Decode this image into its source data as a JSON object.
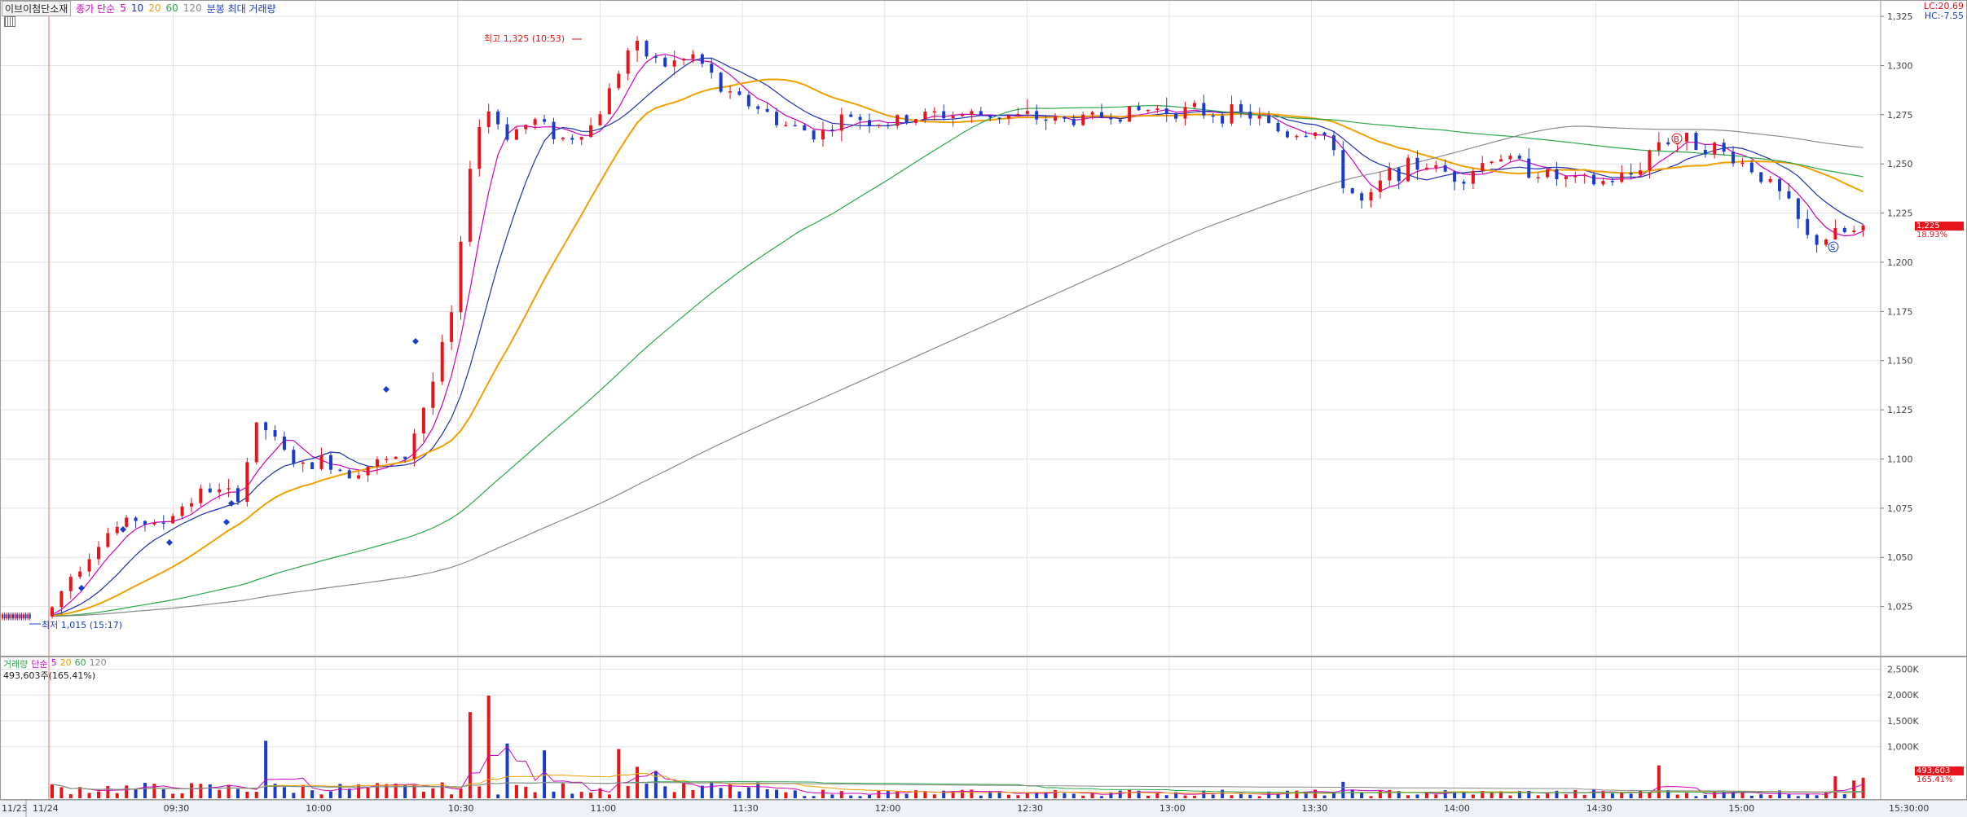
{
  "header": {
    "stock_name": "이브이첨단소재",
    "price_ma_label": "종가 단순",
    "ma_periods": [
      "5",
      "10",
      "20",
      "60",
      "120"
    ],
    "ma_colors": [
      "#d000c0",
      "#1f2fb0",
      "#f0a000",
      "#2aa84a",
      "#8a8a8a"
    ],
    "volume_label": "분봉 최대 거래량",
    "lc_label": "LC:20.69",
    "hc_label": "HC:-7.55"
  },
  "volume_header": {
    "label": "거래량",
    "ma_label": "단순",
    "periods": [
      "5",
      "20",
      "60",
      "120"
    ],
    "current": "493,603주(165.41%)"
  },
  "annotations": {
    "high": "최고 1,325 (10:53)",
    "low": "최저 1,015 (15:17)",
    "badge_b": "B",
    "badge_s": "S"
  },
  "last_price_tag": {
    "price": "1,225",
    "pct": "18.93%"
  },
  "last_volume_tag": {
    "volume": "493,603",
    "pct": "165.41%"
  },
  "colors": {
    "up": "#e8141c",
    "down": "#1a3cc8",
    "grid": "#e3e3e3"
  },
  "chart_data": {
    "type": "candlestick",
    "price_axis": {
      "min": 1000,
      "max": 1330,
      "ticks": [
        1025,
        1050,
        1075,
        1100,
        1125,
        1150,
        1175,
        1200,
        1225,
        1250,
        1275,
        1300,
        1325
      ],
      "tick_labels": [
        "1,025",
        "1,050",
        "1,075",
        "1,100",
        "1,125",
        "1,150",
        "1,175",
        "1,200",
        "1,225",
        "1,250",
        "1,275",
        "1,300",
        "1,325"
      ]
    },
    "volume_axis": {
      "min": 0,
      "max": 2650000,
      "ticks": [
        1000000,
        1500000,
        2000000,
        2500000
      ],
      "tick_labels": [
        "1,000K",
        "1,500K",
        "2,000K",
        "2,500K"
      ]
    },
    "time_labels": [
      {
        "label": "11/23",
        "minute": 0
      },
      {
        "label": "11/24",
        "minute": 0
      },
      {
        "label": "09:30",
        "minute": 30
      },
      {
        "label": "10:00",
        "minute": 60
      },
      {
        "label": "10:30",
        "minute": 90
      },
      {
        "label": "11:00",
        "minute": 120
      },
      {
        "label": "11:30",
        "minute": 150
      },
      {
        "label": "12:00",
        "minute": 180
      },
      {
        "label": "12:30",
        "minute": 210
      },
      {
        "label": "13:00",
        "minute": 240
      },
      {
        "label": "13:30",
        "minute": 270
      },
      {
        "label": "14:00",
        "minute": 300
      },
      {
        "label": "14:30",
        "minute": 330
      },
      {
        "label": "15:00",
        "minute": 360
      },
      {
        "label": "15:30:00",
        "minute": 390
      }
    ],
    "price_path": [
      [
        0,
        1020
      ],
      [
        3,
        1040
      ],
      [
        8,
        1062
      ],
      [
        12,
        1070
      ],
      [
        15,
        1065
      ],
      [
        18,
        1075
      ],
      [
        22,
        1085
      ],
      [
        26,
        1080
      ],
      [
        29,
        1120
      ],
      [
        32,
        1105
      ],
      [
        35,
        1095
      ],
      [
        38,
        1100
      ],
      [
        41,
        1093
      ],
      [
        45,
        1098
      ],
      [
        49,
        1100
      ],
      [
        53,
        1140
      ],
      [
        56,
        1180
      ],
      [
        58,
        1250
      ],
      [
        60,
        1280
      ],
      [
        63,
        1265
      ],
      [
        67,
        1272
      ],
      [
        71,
        1262
      ],
      [
        75,
        1270
      ],
      [
        80,
        1310
      ],
      [
        85,
        1300
      ],
      [
        89,
        1305
      ],
      [
        93,
        1285
      ],
      [
        97,
        1280
      ],
      [
        101,
        1270
      ],
      [
        106,
        1265
      ],
      [
        110,
        1275
      ],
      [
        115,
        1270
      ],
      [
        121,
        1275
      ],
      [
        130,
        1275
      ],
      [
        140,
        1272
      ],
      [
        152,
        1278
      ],
      [
        165,
        1275
      ],
      [
        170,
        1265
      ],
      [
        175,
        1268
      ],
      [
        178,
        1240
      ],
      [
        181,
        1228
      ],
      [
        184,
        1245
      ],
      [
        189,
        1250
      ],
      [
        194,
        1243
      ],
      [
        199,
        1255
      ],
      [
        203,
        1248
      ],
      [
        208,
        1242
      ],
      [
        213,
        1240
      ],
      [
        218,
        1245
      ],
      [
        221,
        1262
      ],
      [
        225,
        1262
      ],
      [
        229,
        1258
      ],
      [
        233,
        1250
      ],
      [
        236,
        1242
      ],
      [
        239,
        1230
      ],
      [
        242,
        1210
      ],
      [
        244,
        1212
      ],
      [
        246,
        1215
      ],
      [
        250,
        1215
      ]
    ],
    "volume_spikes": [
      [
        30,
        0.42
      ],
      [
        58,
        0.63
      ],
      [
        61,
        0.75
      ],
      [
        63,
        0.4
      ],
      [
        68,
        0.35
      ],
      [
        79,
        0.36
      ],
      [
        81,
        0.23
      ],
      [
        83,
        0.2
      ],
      [
        91,
        0.12
      ],
      [
        178,
        0.12
      ],
      [
        221,
        0.24
      ],
      [
        245,
        0.16
      ],
      [
        248,
        0.13
      ],
      [
        250,
        0.15
      ]
    ],
    "reference_lines": {
      "up_vertical_minute": 0
    },
    "series": []
  }
}
